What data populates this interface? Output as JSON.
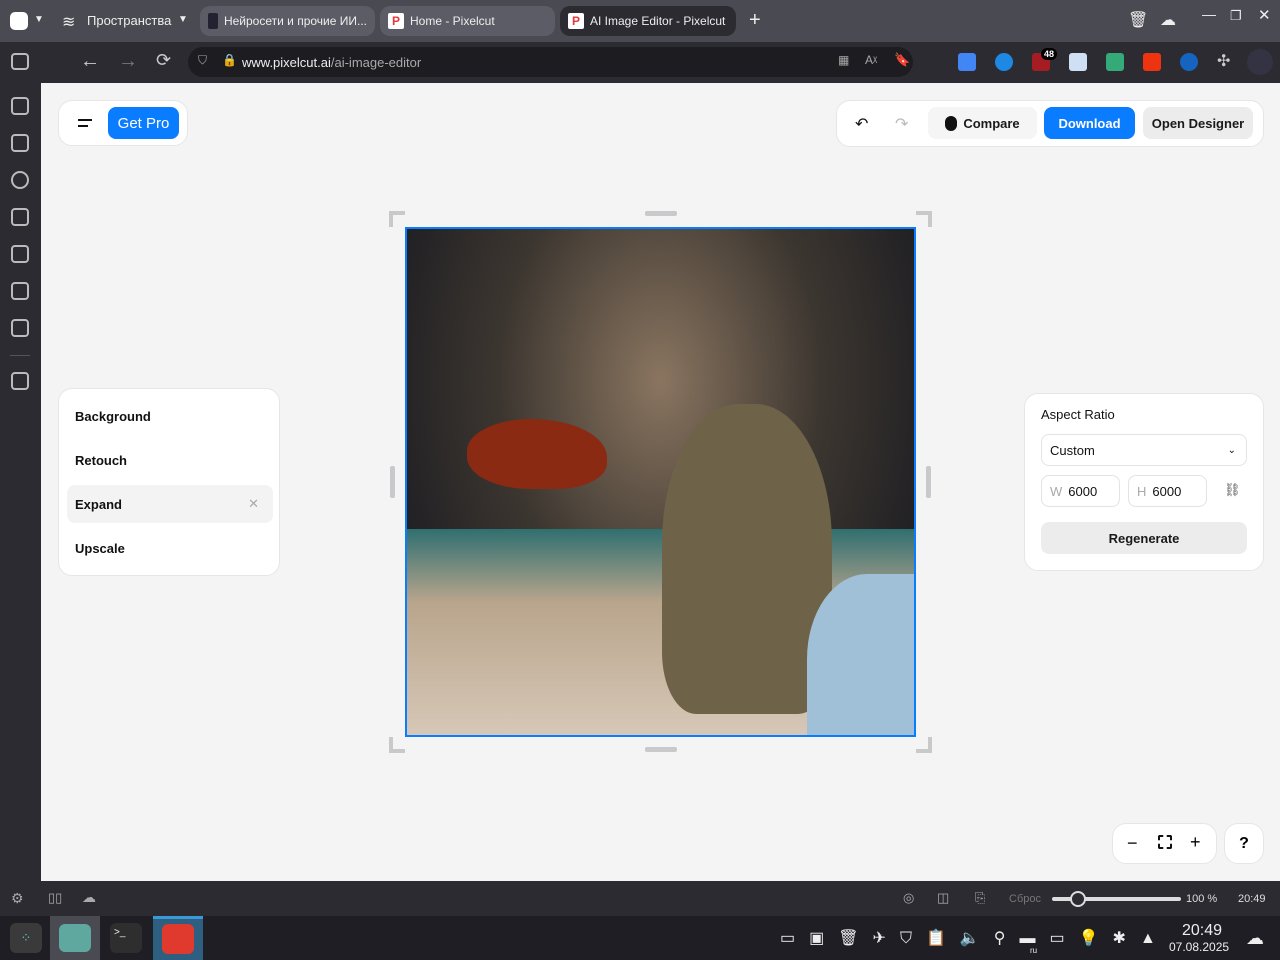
{
  "browser": {
    "spaces_label": "Пространства",
    "tabs": [
      {
        "title": "Нейросети и прочие ИИ..."
      },
      {
        "title": "Home - Pixelcut"
      },
      {
        "title": "AI Image Editor - Pixelcut"
      }
    ],
    "url_domain": "www.pixelcut.ai",
    "url_path": "/ai-image-editor",
    "ext_badge": "48"
  },
  "app": {
    "get_pro": "Get Pro",
    "compare": "Compare",
    "download": "Download",
    "open_designer": "Open Designer",
    "tools": [
      {
        "label": "Background"
      },
      {
        "label": "Retouch"
      },
      {
        "label": "Expand"
      },
      {
        "label": "Upscale"
      }
    ],
    "panel": {
      "title": "Aspect Ratio",
      "select_value": "Custom",
      "w_label": "W",
      "w_value": "6000",
      "h_label": "H",
      "h_value": "6000",
      "regenerate": "Regenerate"
    },
    "help": "?",
    "accent": "#0a7cff"
  },
  "status": {
    "reset": "Сброс",
    "zoom": "100 %",
    "time": "20:49",
    "zoom_fraction": 0.2
  },
  "taskbar": {
    "time": "20:49",
    "date": "07.08.2025",
    "lang": "ru"
  }
}
